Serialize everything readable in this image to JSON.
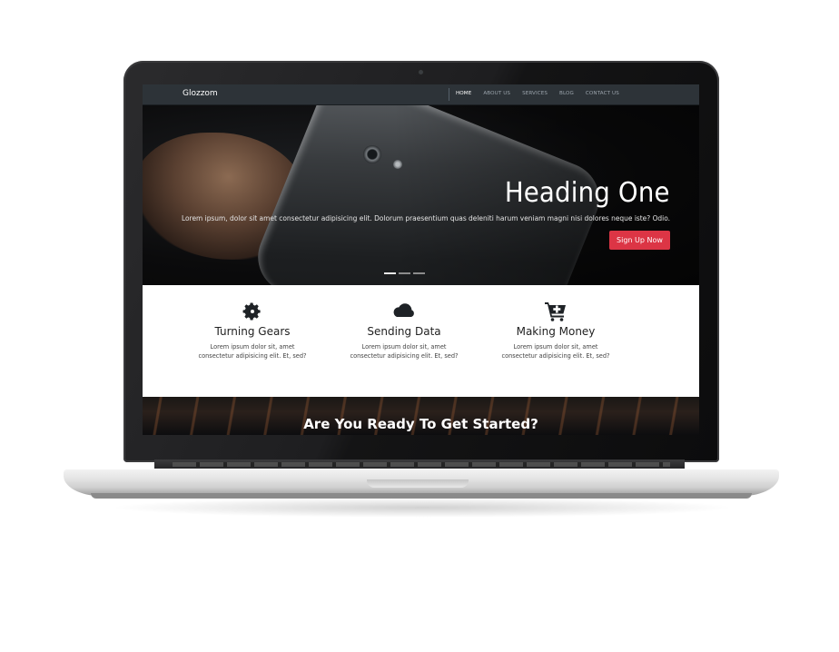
{
  "site": {
    "brand": "Glozzom",
    "nav": [
      {
        "label": "HOME",
        "active": true
      },
      {
        "label": "ABOUT US",
        "active": false
      },
      {
        "label": "SERVICES",
        "active": false
      },
      {
        "label": "BLOG",
        "active": false
      },
      {
        "label": "CONTACT US",
        "active": false
      }
    ]
  },
  "hero": {
    "title": "Heading One",
    "text": "Lorem ipsum, dolor sit amet consectetur adipisicing elit. Dolorum praesentium quas deleniti harum veniam magni nisi dolores neque iste? Odio.",
    "button_label": "Sign Up Now",
    "button_color": "#dc3545",
    "slides": 3,
    "active_slide": 1
  },
  "features": [
    {
      "icon": "gear-icon",
      "title": "Turning Gears",
      "text": "Lorem ipsum dolor sit, amet consectetur adipisicing elit. Et, sed?"
    },
    {
      "icon": "cloud-icon",
      "title": "Sending Data",
      "text": "Lorem ipsum dolor sit, amet consectetur adipisicing elit. Et, sed?"
    },
    {
      "icon": "cart-plus-icon",
      "title": "Making Money",
      "text": "Lorem ipsum dolor sit, amet consectetur adipisicing elit. Et, sed?"
    }
  ],
  "cta": {
    "title": "Are You Ready To Get Started?"
  }
}
